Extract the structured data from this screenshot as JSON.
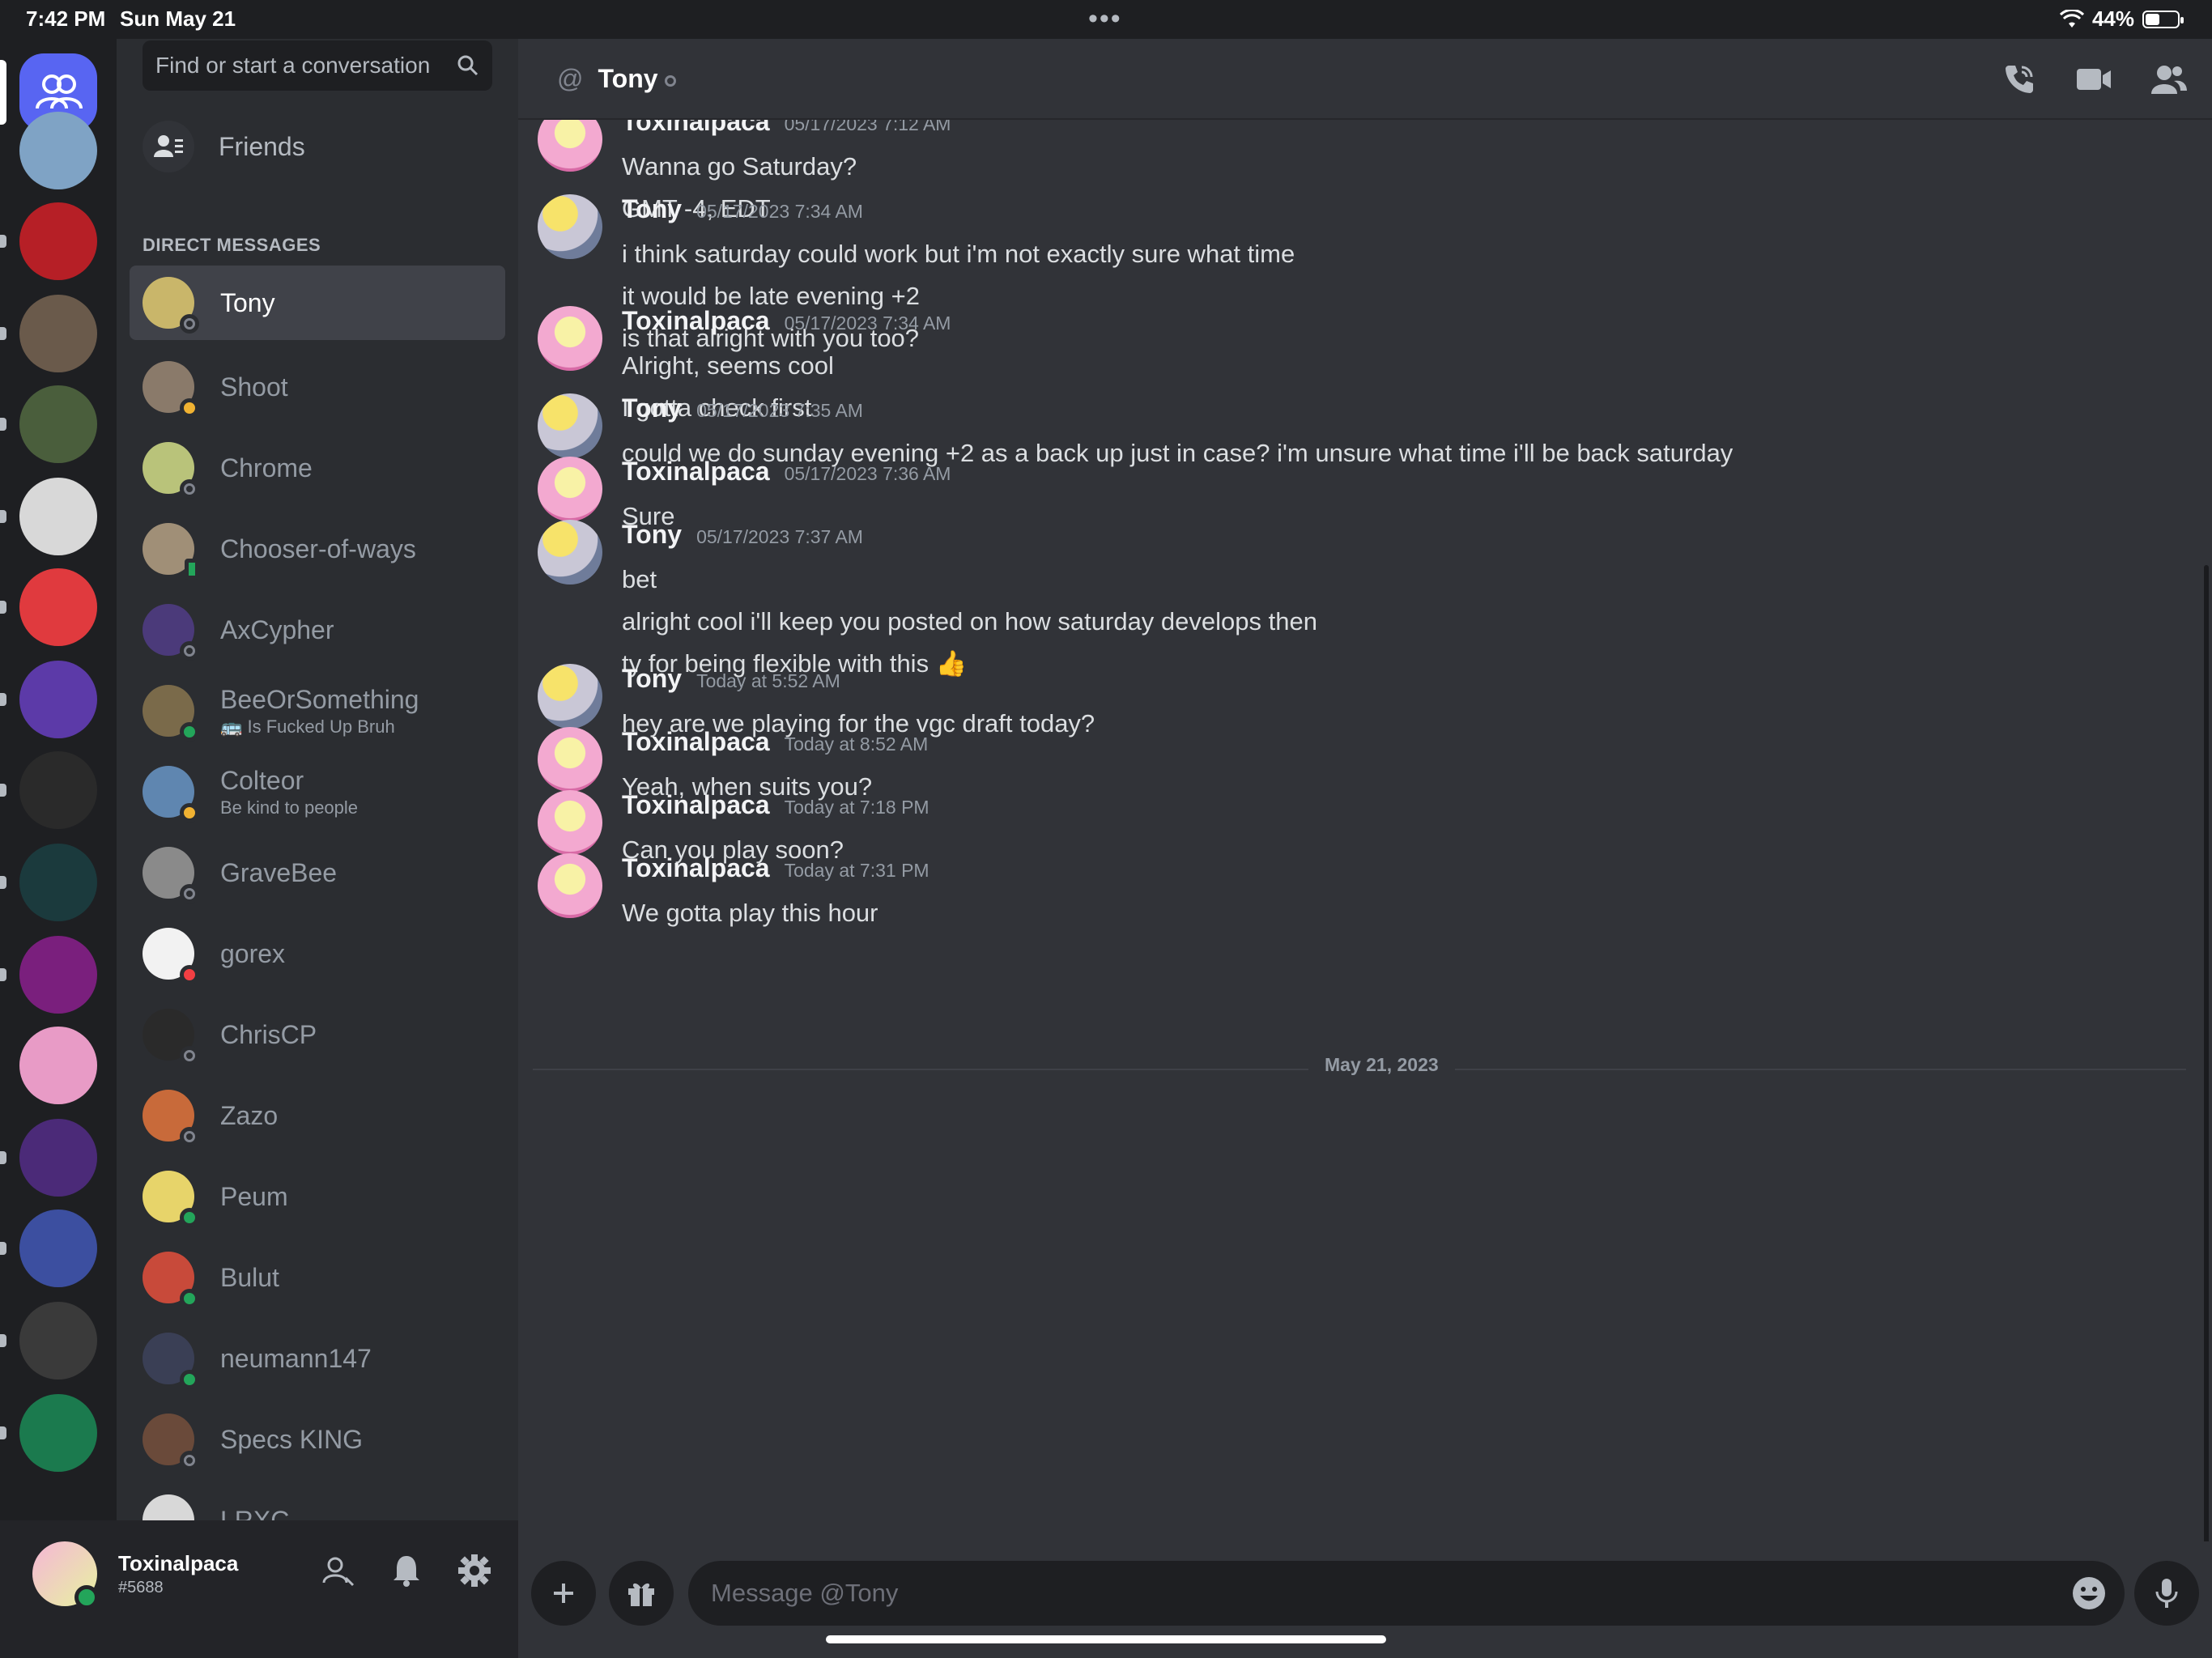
{
  "status_bar": {
    "time": "7:42 PM",
    "date": "Sun May 21",
    "battery": "44%",
    "battery_level": 0.44
  },
  "servers": [
    {
      "name": "server-1",
      "color": "#7fa3c5"
    },
    {
      "name": "server-2",
      "color": "#b61f26"
    },
    {
      "name": "server-3",
      "color": "#6a5a4b"
    },
    {
      "name": "server-4",
      "color": "#4a5e3c"
    },
    {
      "name": "server-5",
      "color": "#d8d8d8"
    },
    {
      "name": "server-6",
      "color": "#e03a3e"
    },
    {
      "name": "server-7",
      "color": "#5c3aa8"
    },
    {
      "name": "server-8",
      "color": "#2a2a2a"
    },
    {
      "name": "server-9",
      "color": "#1b3a3d"
    },
    {
      "name": "server-10",
      "color": "#7a1f7d"
    },
    {
      "name": "server-11",
      "color": "#e89bc6"
    },
    {
      "name": "server-12",
      "color": "#4b2a78"
    },
    {
      "name": "server-13",
      "color": "#3c4fa0"
    },
    {
      "name": "server-14",
      "color": "#3a3a3a"
    },
    {
      "name": "server-15",
      "color": "#1b7a4e"
    }
  ],
  "sidebar": {
    "search_placeholder": "Find or start a conversation",
    "friends_label": "Friends",
    "dm_header": "DIRECT MESSAGES",
    "dms": [
      {
        "name": "Tony",
        "sub": "",
        "status": "offline",
        "avatar_color": "#c9b66a"
      },
      {
        "name": "Shoot",
        "sub": "",
        "status": "idle",
        "avatar_color": "#8a7a6a"
      },
      {
        "name": "Chrome",
        "sub": "",
        "status": "offline",
        "avatar_color": "#b9c37a"
      },
      {
        "name": "Chooser-of-ways",
        "sub": "",
        "status": "mobile",
        "avatar_color": "#a08f77"
      },
      {
        "name": "AxCypher",
        "sub": "",
        "status": "offline",
        "avatar_color": "#4b3a7a"
      },
      {
        "name": "BeeOrSomething",
        "sub": "🚌 Is Fucked Up Bruh",
        "status": "online",
        "avatar_color": "#7a6a4a"
      },
      {
        "name": "Colteor",
        "sub": "Be kind to people",
        "status": "idle",
        "avatar_color": "#5f86b0"
      },
      {
        "name": "GraveBee",
        "sub": "",
        "status": "offline",
        "avatar_color": "#8a8a8a"
      },
      {
        "name": "gorex",
        "sub": "",
        "status": "dnd",
        "avatar_color": "#f2f2f2"
      },
      {
        "name": "ChrisCP",
        "sub": "",
        "status": "offline",
        "avatar_color": "#2a2a2a"
      },
      {
        "name": "Zazo",
        "sub": "",
        "status": "offline",
        "avatar_color": "#c86a3a"
      },
      {
        "name": "Peum",
        "sub": "",
        "status": "online",
        "avatar_color": "#e7d46a"
      },
      {
        "name": "Bulut",
        "sub": "",
        "status": "online",
        "avatar_color": "#c84a3a"
      },
      {
        "name": "neumann147",
        "sub": "",
        "status": "online",
        "avatar_color": "#3a3f55"
      },
      {
        "name": "Specs KING",
        "sub": "",
        "status": "offline",
        "avatar_color": "#6a4a3a"
      },
      {
        "name": "LRXC",
        "sub": "",
        "status": "offline",
        "avatar_color": "#d8d8d8"
      }
    ]
  },
  "user_panel": {
    "name": "Toxinalpaca",
    "tag": "#5688"
  },
  "chat": {
    "at_symbol": "@",
    "title": "Tony",
    "date_divider": "May 21, 2023",
    "input_placeholder": "Message @Tony",
    "messages": [
      {
        "author": "Toxinalpaca",
        "time": "05/17/2023 7:12 AM",
        "lines": [
          "Wanna go Saturday?",
          "GMT -4, EDT"
        ]
      },
      {
        "author": "Tony",
        "time": "05/17/2023 7:34 AM",
        "lines": [
          "i think saturday could work but i'm not exactly sure what time",
          "it would be late evening +2",
          "is that alright with you too?"
        ]
      },
      {
        "author": "Toxinalpaca",
        "time": "05/17/2023 7:34 AM",
        "lines": [
          "Alright, seems cool",
          "I gotta check first"
        ]
      },
      {
        "author": "Tony",
        "time": "05/17/2023 7:35 AM",
        "lines": [
          "could we do sunday evening +2 as a back up just in case? i'm unsure what time i'll be back saturday"
        ]
      },
      {
        "author": "Toxinalpaca",
        "time": "05/17/2023 7:36 AM",
        "lines": [
          "Sure"
        ]
      },
      {
        "author": "Tony",
        "time": "05/17/2023 7:37 AM",
        "lines": [
          "bet",
          "alright cool i'll keep you posted on how saturday develops then",
          "ty for being flexible with this 👍"
        ]
      },
      {
        "author": "Tony",
        "time": "Today at 5:52 AM",
        "lines": [
          "hey are we playing for the vgc draft today?"
        ]
      },
      {
        "author": "Toxinalpaca",
        "time": "Today at 8:52 AM",
        "lines": [
          "Yeah, when suits you?"
        ]
      },
      {
        "author": "Toxinalpaca",
        "time": "Today at 7:18 PM",
        "lines": [
          "Can you play soon?"
        ]
      },
      {
        "author": "Toxinalpaca",
        "time": "Today at 7:31 PM",
        "lines": [
          "We gotta play this hour"
        ]
      }
    ]
  }
}
